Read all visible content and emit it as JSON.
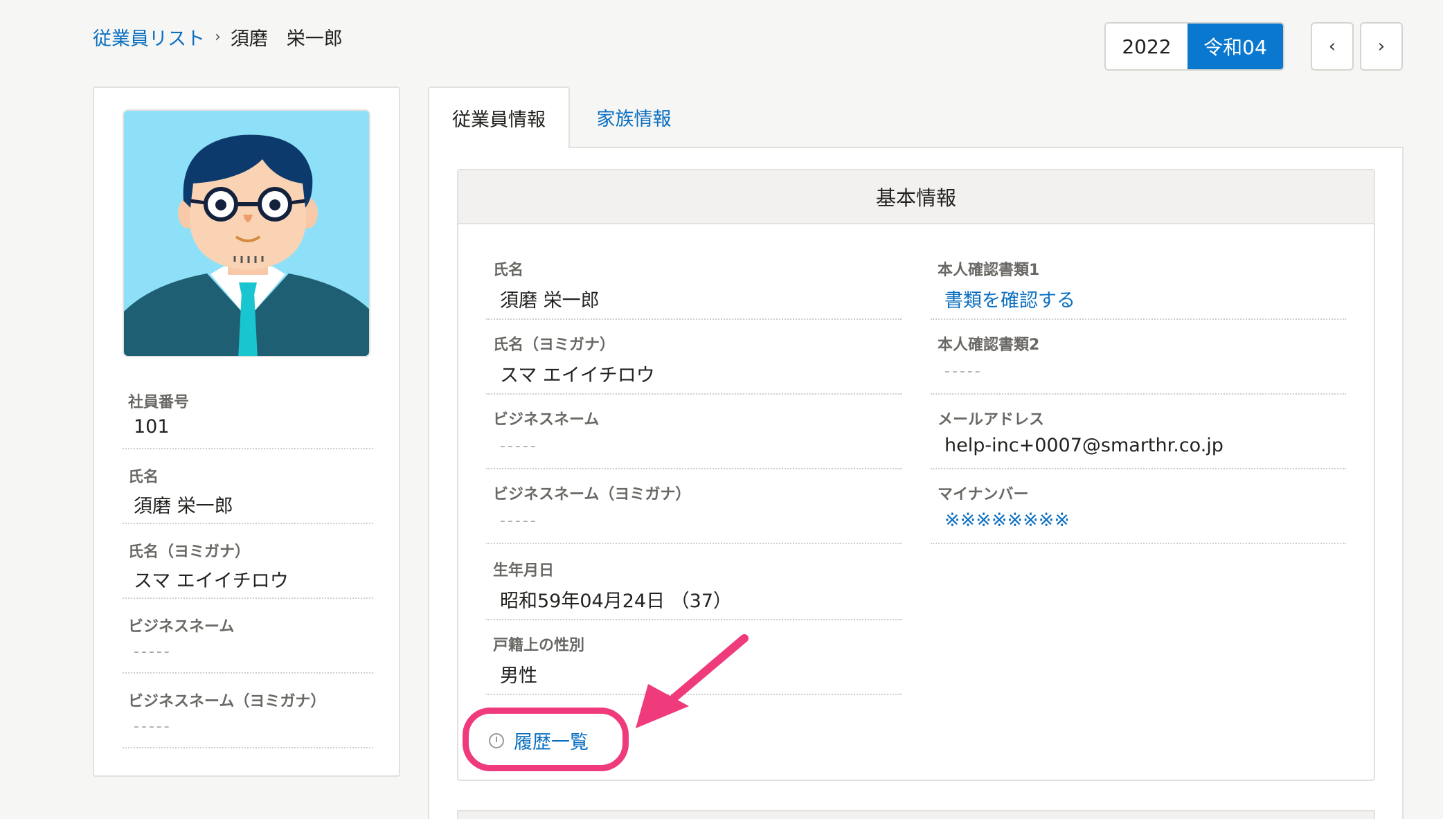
{
  "breadcrumb": {
    "parent": "従業員リスト",
    "separator": "›",
    "current": "須磨　栄一郎"
  },
  "year_toggle": {
    "western": "2022",
    "japanese": "令和04",
    "selected": "japanese"
  },
  "nav": {
    "prev": "‹",
    "next": "›"
  },
  "profile": {
    "fields": [
      {
        "label": "社員番号",
        "value": "101"
      },
      {
        "label": "氏名",
        "value": "須磨 栄一郎"
      },
      {
        "label": "氏名（ヨミガナ）",
        "value": "スマ エイイチロウ"
      },
      {
        "label": "ビジネスネーム",
        "value": "-----"
      },
      {
        "label": "ビジネスネーム（ヨミガナ）",
        "value": "-----"
      }
    ]
  },
  "tabs": {
    "active": "従業員情報",
    "inactive": "家族情報"
  },
  "section": {
    "title": "基本情報",
    "left_fields": [
      {
        "label": "氏名",
        "value": "須磨 栄一郎"
      },
      {
        "label": "氏名（ヨミガナ）",
        "value": "スマ エイイチロウ"
      },
      {
        "label": "ビジネスネーム",
        "value": "-----"
      },
      {
        "label": "ビジネスネーム（ヨミガナ）",
        "value": "-----"
      },
      {
        "label": "生年月日",
        "value": "昭和59年04月24日 （37）"
      },
      {
        "label": "戸籍上の性別",
        "value": "男性"
      }
    ],
    "right_fields": [
      {
        "label": "本人確認書類1",
        "value": "書類を確認する"
      },
      {
        "label": "本人確認書類2",
        "value": "-----"
      },
      {
        "label": "メールアドレス",
        "value": "help-inc+0007@smarthr.co.jp"
      },
      {
        "label": "マイナンバー",
        "value": "※※※※※※※※"
      }
    ],
    "history_link": "履歴一覧"
  },
  "colors": {
    "link": "#0b6fc0",
    "accent": "#0b78d0",
    "highlight": "#ef3a7b",
    "avatar_bg": "#8ee0f8"
  }
}
